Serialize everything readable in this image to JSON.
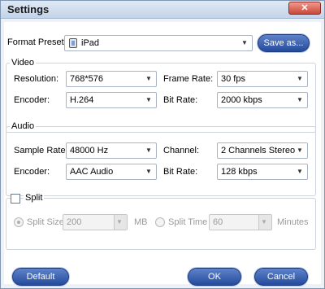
{
  "window": {
    "title": "Settings",
    "close_label": "✕"
  },
  "format": {
    "label": "Format Preset:",
    "value": "iPad",
    "save_as": "Save as..."
  },
  "video": {
    "legend": "Video",
    "resolution_label": "Resolution:",
    "resolution_value": "768*576",
    "frame_rate_label": "Frame Rate:",
    "frame_rate_value": "30 fps",
    "encoder_label": "Encoder:",
    "encoder_value": "H.264",
    "bit_rate_label": "Bit Rate:",
    "bit_rate_value": "2000 kbps"
  },
  "audio": {
    "legend": "Audio",
    "sample_rate_label": "Sample Rate:",
    "sample_rate_value": "48000 Hz",
    "channel_label": "Channel:",
    "channel_value": "2 Channels Stereo",
    "encoder_label": "Encoder:",
    "encoder_value": "AAC Audio",
    "bit_rate_label": "Bit Rate:",
    "bit_rate_value": "128 kbps"
  },
  "split": {
    "label": "Split",
    "split_size_label": "Split Size",
    "split_size_value": "200",
    "mb_label": "MB",
    "split_time_label": "Split Time",
    "split_time_value": "60",
    "minutes_label": "Minutes"
  },
  "buttons": {
    "default": "Default",
    "ok": "OK",
    "cancel": "Cancel"
  }
}
